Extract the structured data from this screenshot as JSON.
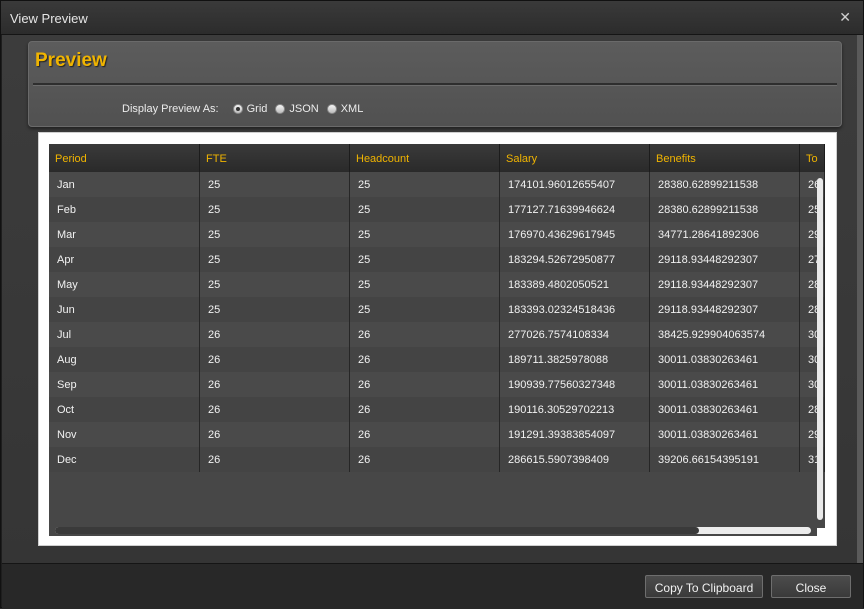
{
  "window": {
    "title": "View Preview"
  },
  "panel": {
    "title": "Preview",
    "display_label": "Display Preview As:",
    "options": [
      "Grid",
      "JSON",
      "XML"
    ],
    "selected": "Grid"
  },
  "grid": {
    "columns": [
      "Period",
      "FTE",
      "Headcount",
      "Salary",
      "Benefits",
      "To"
    ],
    "rows": [
      [
        "Jan",
        "25",
        "25",
        "174101.96012655407",
        "28380.62899211538",
        "26"
      ],
      [
        "Feb",
        "25",
        "25",
        "177127.71639946624",
        "28380.62899211538",
        "25"
      ],
      [
        "Mar",
        "25",
        "25",
        "176970.43629617945",
        "34771.28641892306",
        "29"
      ],
      [
        "Apr",
        "25",
        "25",
        "183294.52672950877",
        "29118.93448292307",
        "27"
      ],
      [
        "May",
        "25",
        "25",
        "183389.4802050521",
        "29118.93448292307",
        "28"
      ],
      [
        "Jun",
        "25",
        "25",
        "183393.02324518436",
        "29118.93448292307",
        "28"
      ],
      [
        "Jul",
        "26",
        "26",
        "277026.7574108334",
        "38425.929904063574",
        "30"
      ],
      [
        "Aug",
        "26",
        "26",
        "189711.3825978088",
        "30011.03830263461",
        "30"
      ],
      [
        "Sep",
        "26",
        "26",
        "190939.77560327348",
        "30011.03830263461",
        "30"
      ],
      [
        "Oct",
        "26",
        "26",
        "190116.30529702213",
        "30011.03830263461",
        "28"
      ],
      [
        "Nov",
        "26",
        "26",
        "191291.39383854097",
        "30011.03830263461",
        "29"
      ],
      [
        "Dec",
        "26",
        "26",
        "286615.5907398409",
        "39206.66154395191",
        "31"
      ]
    ]
  },
  "footer": {
    "copy_label": "Copy To Clipboard",
    "close_label": "Close"
  },
  "colors": {
    "accent": "#f0b400",
    "background": "#3a3a3a"
  },
  "icons": {
    "close": "close-icon"
  }
}
